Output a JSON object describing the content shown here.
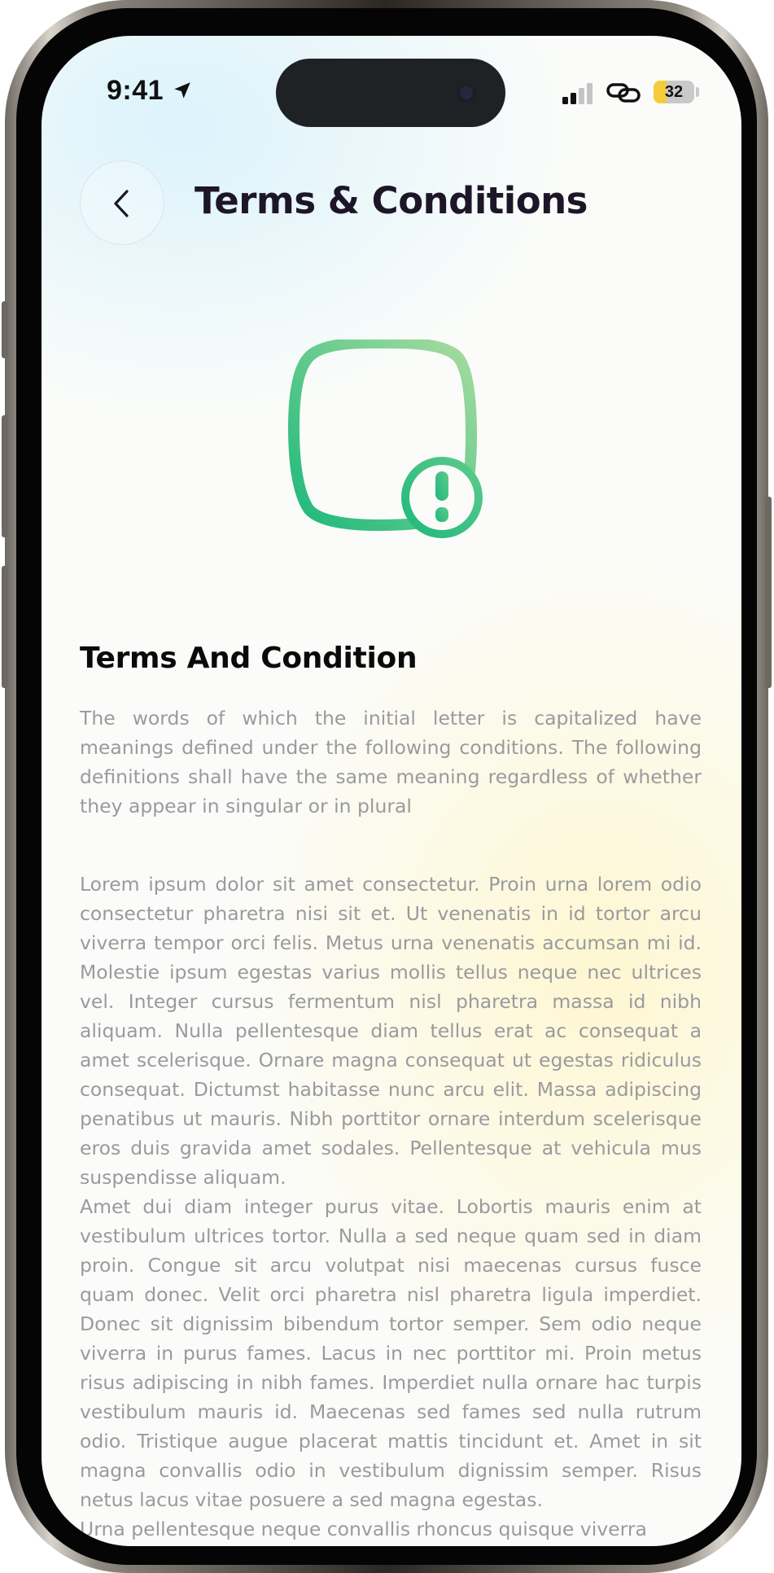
{
  "status_bar": {
    "time": "9:41",
    "battery_level": "32",
    "battery_fraction": 0.32,
    "icons": [
      "location-arrow-icon",
      "signal-icon",
      "link-icon",
      "battery-icon"
    ]
  },
  "header": {
    "title": "Terms & Conditions",
    "back_icon": "chevron-left-icon"
  },
  "hero": {
    "icon": "document-alert-icon",
    "accent_colors": [
      "#1db87b",
      "#a8dc9f"
    ]
  },
  "content": {
    "heading": "Terms And Condition",
    "intro": "The words of which the initial letter is capitalized have meanings defined under the following conditions. The following definitions shall have the same meaning regardless of whether they appear in singular or in plural",
    "paragraphs": [
      "Lorem ipsum dolor sit amet consectetur. Proin urna lorem odio consectetur pharetra nisi sit et. Ut venenatis in id tortor arcu viverra tempor orci felis. Metus urna venenatis accumsan mi id. Molestie ipsum egestas varius mollis tellus neque nec ultrices vel. Integer cursus fermentum nisl pharetra massa id nibh aliquam. Nulla pellentesque diam tellus erat ac consequat a amet scelerisque. Ornare magna consequat ut egestas ridiculus consequat. Dictumst habitasse nunc arcu elit. Massa adipiscing penatibus ut mauris. Nibh porttitor ornare interdum scelerisque eros duis gravida amet sodales. Pellentesque at vehicula mus suspendisse aliquam.",
      "Amet dui diam integer purus vitae. Lobortis mauris enim at vestibulum ultrices tortor. Nulla a sed neque quam sed in diam proin. Congue sit arcu volutpat nisi maecenas cursus fusce quam donec. Velit orci pharetra nisl pharetra ligula imperdiet. Donec sit dignissim bibendum tortor semper. Sem odio neque viverra in purus fames. Lacus in nec porttitor mi. Proin metus risus adipiscing in nibh fames. Imperdiet nulla ornare hac turpis vestibulum mauris id. Maecenas sed fames sed nulla rutrum odio. Tristique augue placerat mattis tincidunt et. Amet in sit magna convallis odio in vestibulum dignissim semper. Risus netus lacus vitae posuere a sed magna egestas.",
      "Urna pellentesque neque convallis rhoncus quisque viverra"
    ]
  }
}
